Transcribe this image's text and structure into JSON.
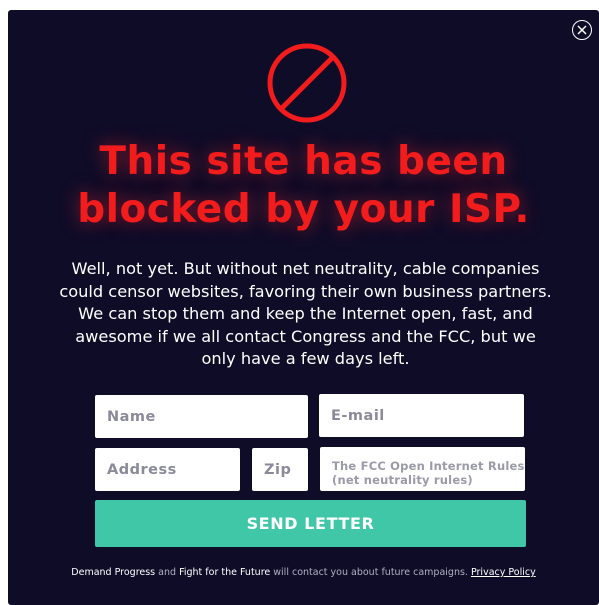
{
  "modal": {
    "close_icon": "close-icon",
    "block_icon": "prohibited-icon",
    "accent_color": "#f21c1c",
    "background_color": "#0f0c28",
    "button_color": "#3fc7a8",
    "headline_line1": "This site has been",
    "headline_line2": "blocked by your ISP.",
    "body": "Well, not yet. But without net neutrality, cable companies could censor websites, favoring their own business partners. We can stop them and keep the Internet open, fast, and awesome if we all contact Congress and the FCC, but we only have a few days left."
  },
  "form": {
    "name_placeholder": "Name",
    "email_placeholder": "E-mail",
    "address_placeholder": "Address",
    "zip_placeholder": "Zip",
    "comment_placeholder": "The FCC Open Internet Rules (net neutrality rules)",
    "submit_label": "SEND LETTER"
  },
  "footer": {
    "org1": "Demand Progress",
    "and": "and",
    "org2": "Fight for the Future",
    "text": "will contact you about future  campaigns.",
    "privacy_link": "Privacy Policy"
  }
}
